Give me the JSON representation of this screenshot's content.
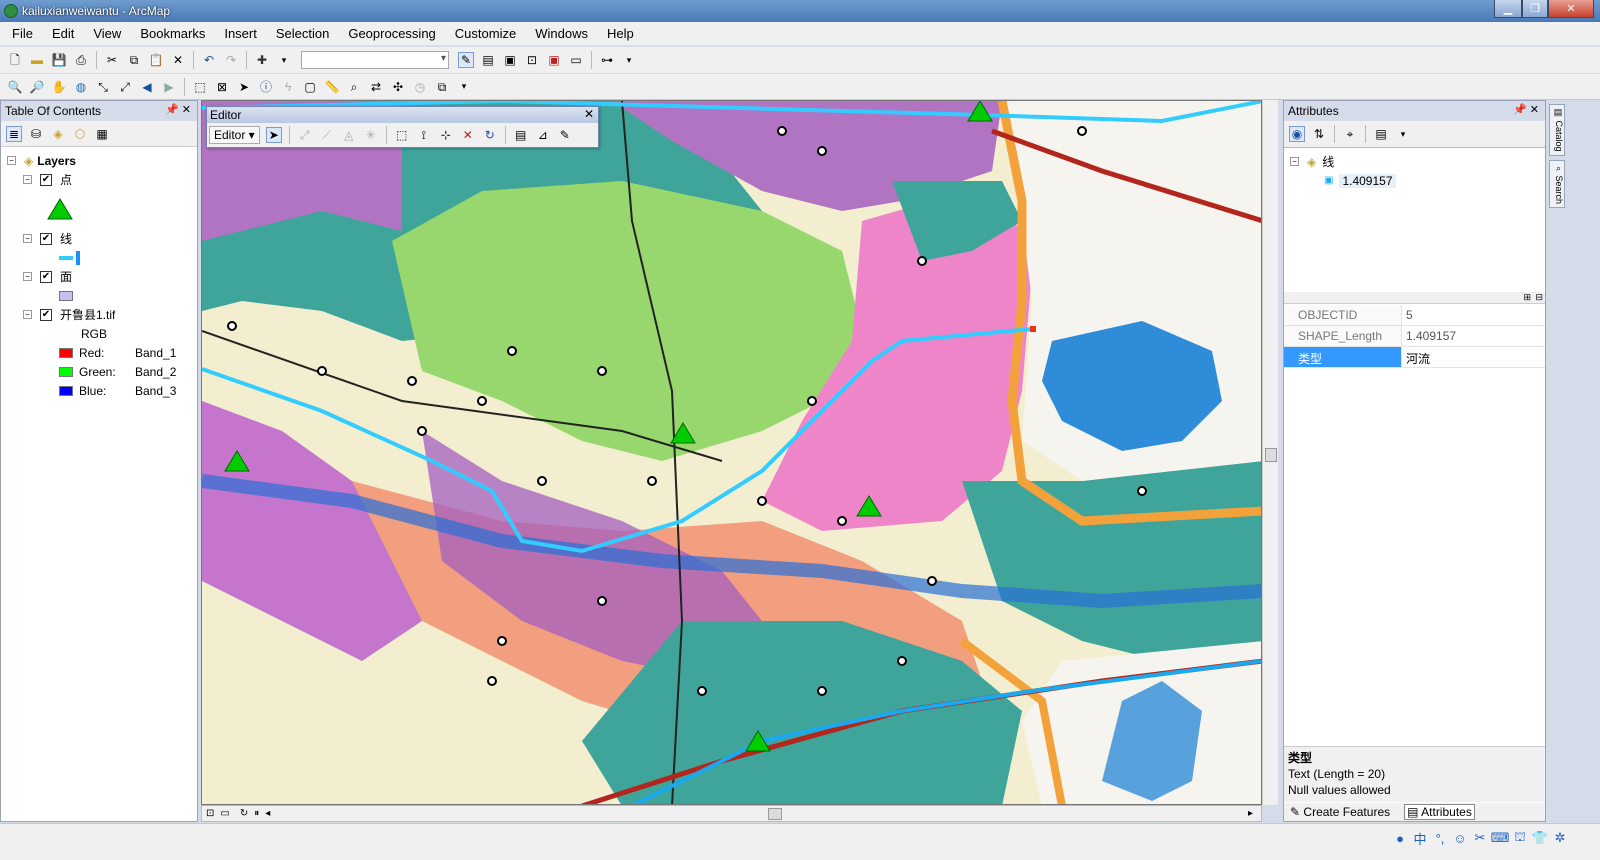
{
  "window": {
    "title": "kailuxianweiwantu - ArcMap"
  },
  "menu": [
    "File",
    "Edit",
    "View",
    "Bookmarks",
    "Insert",
    "Selection",
    "Geoprocessing",
    "Customize",
    "Windows",
    "Help"
  ],
  "toc": {
    "title": "Table Of Contents",
    "root": "Layers",
    "layers": [
      {
        "name": "点"
      },
      {
        "name": "线"
      },
      {
        "name": "面"
      },
      {
        "name": "开鲁县1.tif",
        "sub": "RGB"
      }
    ],
    "bands": [
      {
        "label": "Red:",
        "band": "Band_1",
        "color": "#ff0000"
      },
      {
        "label": "Green:",
        "band": "Band_2",
        "color": "#00ff00"
      },
      {
        "label": "Blue:",
        "band": "Band_3",
        "color": "#0000ff"
      }
    ]
  },
  "editor": {
    "title": "Editor",
    "menu_label": "Editor ▾"
  },
  "attributes": {
    "title": "Attributes",
    "layer": "线",
    "feature": "1.409157",
    "rows": [
      {
        "field": "OBJECTID",
        "value": "5"
      },
      {
        "field": "SHAPE_Length",
        "value": "1.409157"
      },
      {
        "field": "类型",
        "value": "河流"
      }
    ],
    "desc_title": "类型",
    "desc_type": "Text (Length = 20)",
    "desc_null": "Null values allowed",
    "tabs": [
      "Create Features",
      "Attributes"
    ]
  },
  "side_tabs": [
    "Catalog",
    "Search"
  ],
  "colors": {
    "point": "#00cc00",
    "line": "#33ccff",
    "polygon": "#ccbbee",
    "selection": "#3399ff"
  }
}
